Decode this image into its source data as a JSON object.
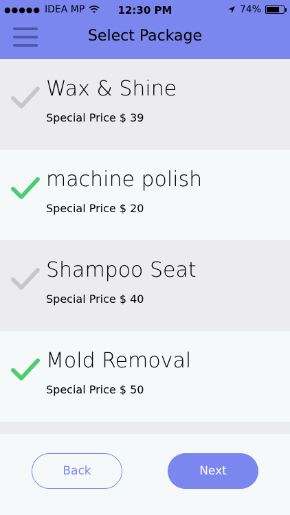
{
  "status_bar": {
    "carrier": "IDEA MP",
    "time": "12:30 PM",
    "battery": "74%",
    "battery_level": 0.74
  },
  "header": {
    "title": "Select Package",
    "menu_icon": "hamburger-menu-icon"
  },
  "packages": [
    {
      "name": "Wax & Shine",
      "price": "Special Price $ 39",
      "selected": false
    },
    {
      "name": "machine polish",
      "price": "Special Price $ 20",
      "selected": true
    },
    {
      "name": "Shampoo Seat",
      "price": "Special Price $ 40",
      "selected": false
    },
    {
      "name": "Mold Removal",
      "price": "Special Price $ 50",
      "selected": true
    }
  ],
  "footer": {
    "back_label": "Back",
    "next_label": "Next"
  },
  "colors": {
    "accent": "#7b86ef",
    "check_selected": "#4ccd6f",
    "check_unselected": "#c7c7c7"
  }
}
